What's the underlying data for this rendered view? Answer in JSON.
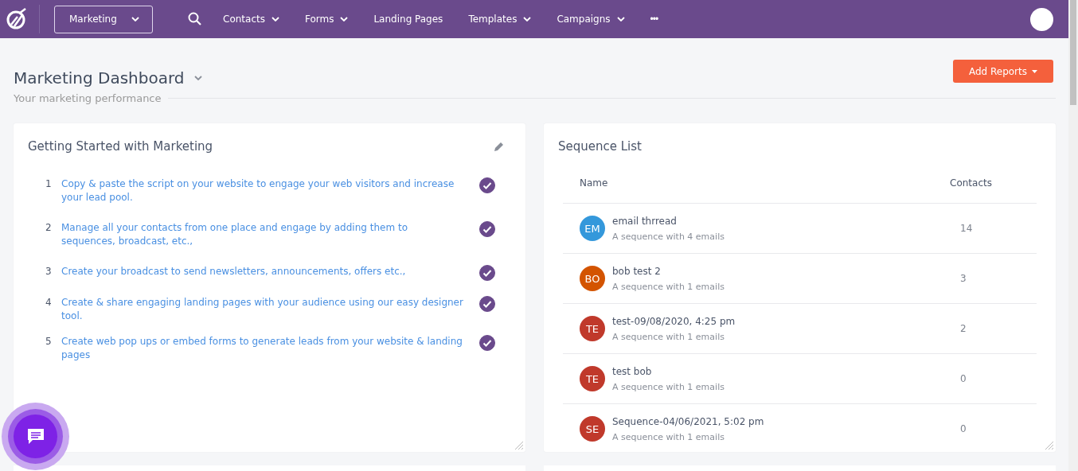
{
  "nav": {
    "workspace": "Marketing",
    "items": [
      {
        "label": "Contacts",
        "dropdown": true
      },
      {
        "label": "Forms",
        "dropdown": true
      },
      {
        "label": "Landing Pages",
        "dropdown": false
      },
      {
        "label": "Templates",
        "dropdown": true
      },
      {
        "label": "Campaigns",
        "dropdown": true
      }
    ],
    "more": "•••"
  },
  "header": {
    "title": "Marketing Dashboard",
    "subtitle": "Your marketing performance",
    "add_button": "Add Reports"
  },
  "getting_started": {
    "title": "Getting Started with Marketing",
    "steps": [
      {
        "number": "1",
        "text": "Copy & paste the script on your website to engage your web visitors and increase your lead pool.",
        "done": true
      },
      {
        "number": "2",
        "text": "Manage all your contacts from one place and engage by adding them to sequences, broadcast, etc.,",
        "done": true
      },
      {
        "number": "3",
        "text": "Create your broadcast to send newsletters, announcements, offers etc.,",
        "done": true
      },
      {
        "number": "4",
        "text": "Create & share engaging landing pages with your audience using our easy designer tool.",
        "done": true
      },
      {
        "number": "5",
        "text": "Create web pop ups or embed forms to generate leads from your website & landing pages",
        "done": true
      }
    ]
  },
  "sequence_list": {
    "title": "Sequence List",
    "columns": [
      "Name",
      "Contacts"
    ],
    "rows": [
      {
        "initials": "EM",
        "color": "#3498db",
        "name": "email thrread",
        "description": "A sequence with 4 emails",
        "contacts": "14"
      },
      {
        "initials": "BO",
        "color": "#d35400",
        "name": "bob test 2",
        "description": "A sequence with 1 emails",
        "contacts": "3"
      },
      {
        "initials": "TE",
        "color": "#c0392b",
        "name": "test-09/08/2020, 4:25 pm",
        "description": "A sequence with 1 emails",
        "contacts": "2"
      },
      {
        "initials": "TE",
        "color": "#c0392b",
        "name": "test bob",
        "description": "A sequence with 1 emails",
        "contacts": "0"
      },
      {
        "initials": "SE",
        "color": "#c0392b",
        "name": "Sequence-04/06/2021, 5:02 pm",
        "description": "A sequence with 1 emails",
        "contacts": "0"
      }
    ]
  }
}
